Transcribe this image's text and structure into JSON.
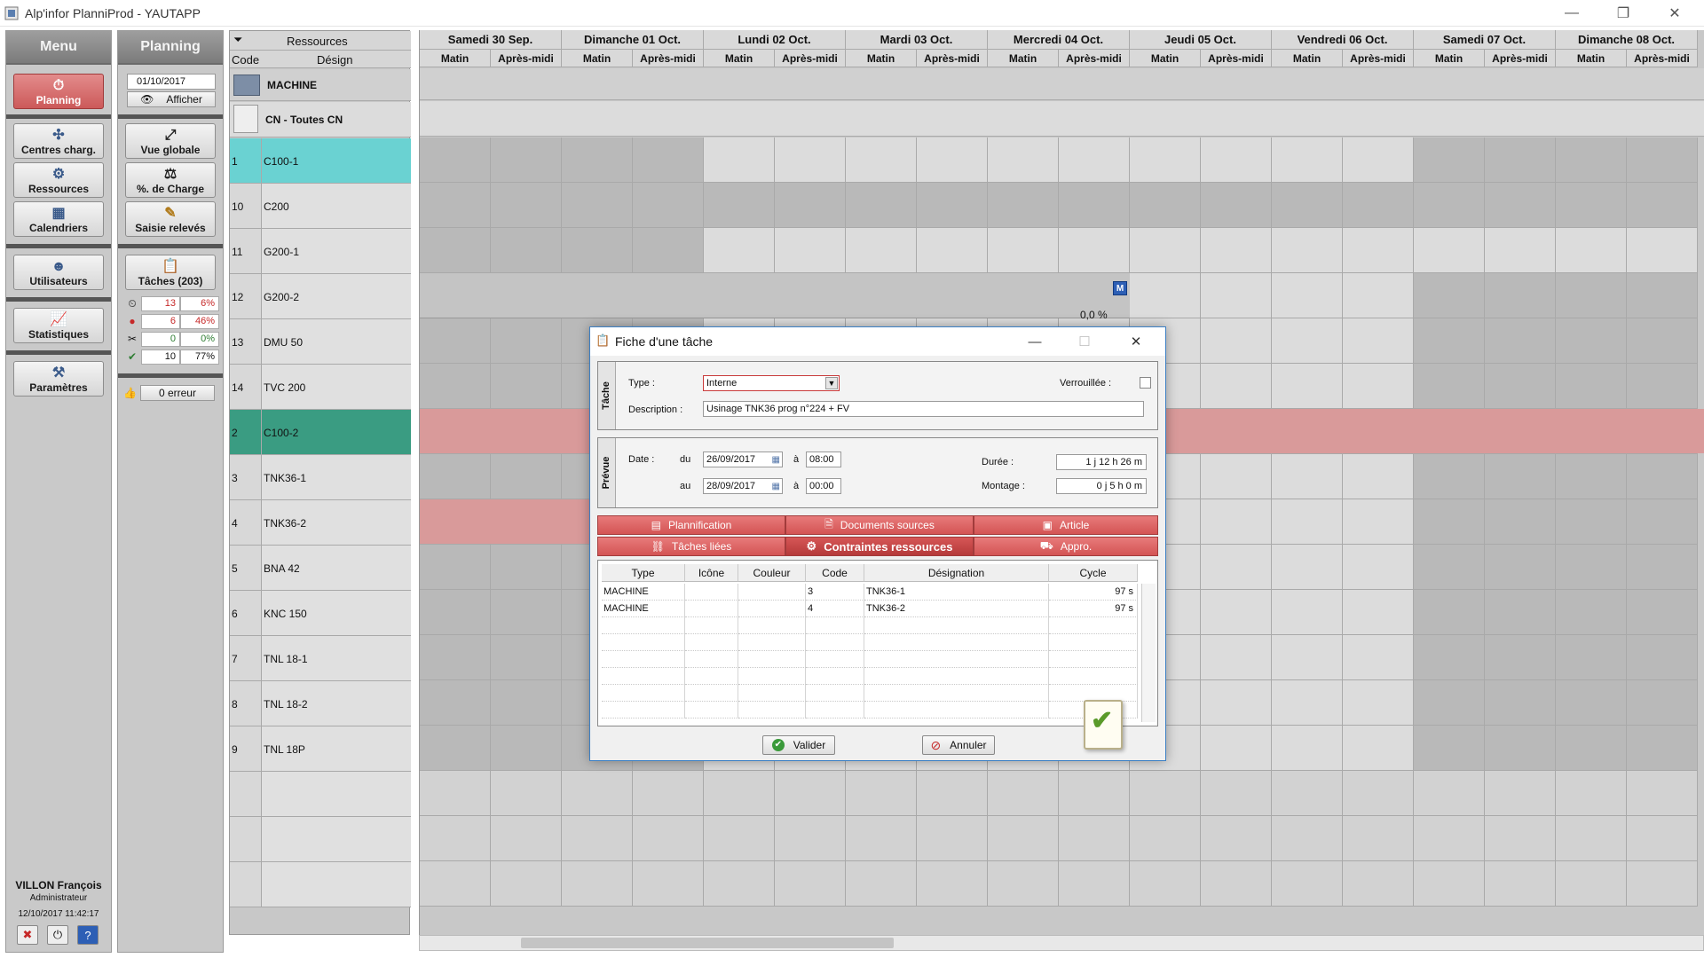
{
  "window": {
    "title": "Alp'infor PlanniProd - YAUTAPP",
    "minimize": "—",
    "restore": "❐",
    "close": "✕"
  },
  "menu": {
    "header": "Menu",
    "buttons": [
      "Planning",
      "Centres charg.",
      "Ressources",
      "Calendriers",
      "Utilisateurs",
      "Statistiques",
      "Paramètres"
    ],
    "user_name": "VILLON François",
    "user_role": "Administrateur",
    "datetime": "12/10/2017 11:42:17"
  },
  "planning": {
    "header": "Planning",
    "date": "01/10/2017",
    "afficher": "Afficher",
    "buttons": [
      "Vue globale",
      "%. de Charge",
      "Saisie relevés",
      "Tâches (203)"
    ],
    "stats": [
      {
        "value": "13",
        "pct": "6%",
        "color": "#c62828"
      },
      {
        "value": "6",
        "pct": "46%",
        "color": "#c62828"
      },
      {
        "value": "0",
        "pct": "0%",
        "color": "#2e7d32"
      },
      {
        "value": "10",
        "pct": "77%",
        "color": "#111111"
      }
    ],
    "erreur": "0 erreur"
  },
  "resources": {
    "header": "Ressources",
    "col_code": "Code",
    "col_design": "Désign",
    "group": "MACHINE",
    "subgroup": "CN - Toutes CN",
    "rows": [
      {
        "code": "1",
        "name": "C100-1"
      },
      {
        "code": "10",
        "name": "C200"
      },
      {
        "code": "11",
        "name": "G200-1"
      },
      {
        "code": "12",
        "name": "G200-2"
      },
      {
        "code": "13",
        "name": "DMU 50"
      },
      {
        "code": "14",
        "name": "TVC 200"
      },
      {
        "code": "2",
        "name": "C100-2"
      },
      {
        "code": "3",
        "name": "TNK36-1"
      },
      {
        "code": "4",
        "name": "TNK36-2"
      },
      {
        "code": "5",
        "name": "BNA 42"
      },
      {
        "code": "6",
        "name": "KNC 150"
      },
      {
        "code": "7",
        "name": "TNL 18-1"
      },
      {
        "code": "8",
        "name": "TNL 18-2"
      },
      {
        "code": "9",
        "name": "TNL 18P"
      }
    ]
  },
  "timeline": {
    "days": [
      "Samedi 30 Sep.",
      "Dimanche 01 Oct.",
      "Lundi 02 Oct.",
      "Mardi 03 Oct.",
      "Mercredi 04 Oct.",
      "Jeudi 05 Oct.",
      "Vendredi 06 Oct.",
      "Samedi 07 Oct.",
      "Dimanche 08 Oct."
    ],
    "half_am": "Matin",
    "half_pm": "Après-midi",
    "marker": "M",
    "load_label": "0,0 %"
  },
  "dialog": {
    "title": "Fiche d'une tâche",
    "section_tache": "Tâche",
    "type_label": "Type :",
    "type_value": "Interne",
    "verrouillee_label": "Verrouillée :",
    "description_label": "Description :",
    "description_value": "Usinage TNK36 prog n°224 + FV",
    "section_prevue": "Prévue",
    "date_label": "Date :",
    "du_label": "du",
    "au_label": "au",
    "a_label": "à",
    "date_from": "26/09/2017",
    "time_from": "08:00",
    "date_to": "28/09/2017",
    "time_to": "00:00",
    "duree_label": "Durée :",
    "duree_value": "1 j  12 h  26 m",
    "montage_label": "Montage :",
    "montage_value": "0 j    5 h    0 m",
    "tabs": [
      "Plannification",
      "Documents sources",
      "Article",
      "Tâches liées",
      "Contraintes ressources",
      "Appro."
    ],
    "grid_headers": [
      "Type",
      "Icône",
      "Couleur",
      "Code",
      "Désignation",
      "Cycle"
    ],
    "grid_rows": [
      {
        "type": "MACHINE",
        "code": "3",
        "designation": "TNK36-1",
        "cycle": "97 s"
      },
      {
        "type": "MACHINE",
        "code": "4",
        "designation": "TNK36-2",
        "cycle": "97 s"
      }
    ],
    "valider": "Valider",
    "annuler": "Annuler"
  }
}
